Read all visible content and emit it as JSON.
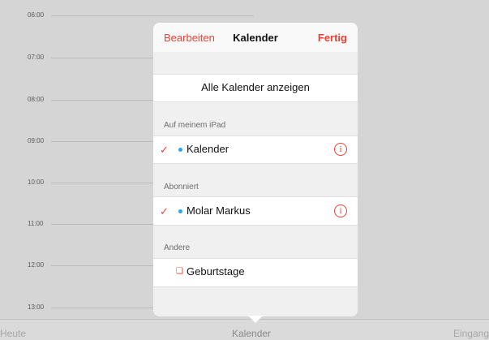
{
  "timeline": {
    "hours": [
      "06:00",
      "07:00",
      "08:00",
      "09:00",
      "10:00",
      "11:00",
      "12:00",
      "13:00"
    ]
  },
  "tabbar": {
    "today": "Heute",
    "calendars": "Kalender",
    "inbox": "Eingang"
  },
  "popover": {
    "edit": "Bearbeiten",
    "title": "Kalender",
    "done": "Fertig",
    "show_all": "Alle Kalender anzeigen",
    "sections": [
      {
        "header": "Auf meinem iPad",
        "items": [
          {
            "name": "Kalender",
            "checked": true,
            "dot_color": "#2aa3f3"
          }
        ]
      },
      {
        "header": "Abonniert",
        "items": [
          {
            "name": "Molar Markus",
            "checked": true,
            "dot_color": "#2aa3f3"
          }
        ]
      },
      {
        "header": "Andere",
        "items": [
          {
            "name": "Geburtstage",
            "checked": false,
            "icon": "gift-icon"
          }
        ]
      }
    ],
    "check_glyph": "✓",
    "info_glyph": "i"
  },
  "colors": {
    "accent": "#f03e30",
    "calendar_dot": "#2aa3f3",
    "background": "#d5d5d5"
  }
}
